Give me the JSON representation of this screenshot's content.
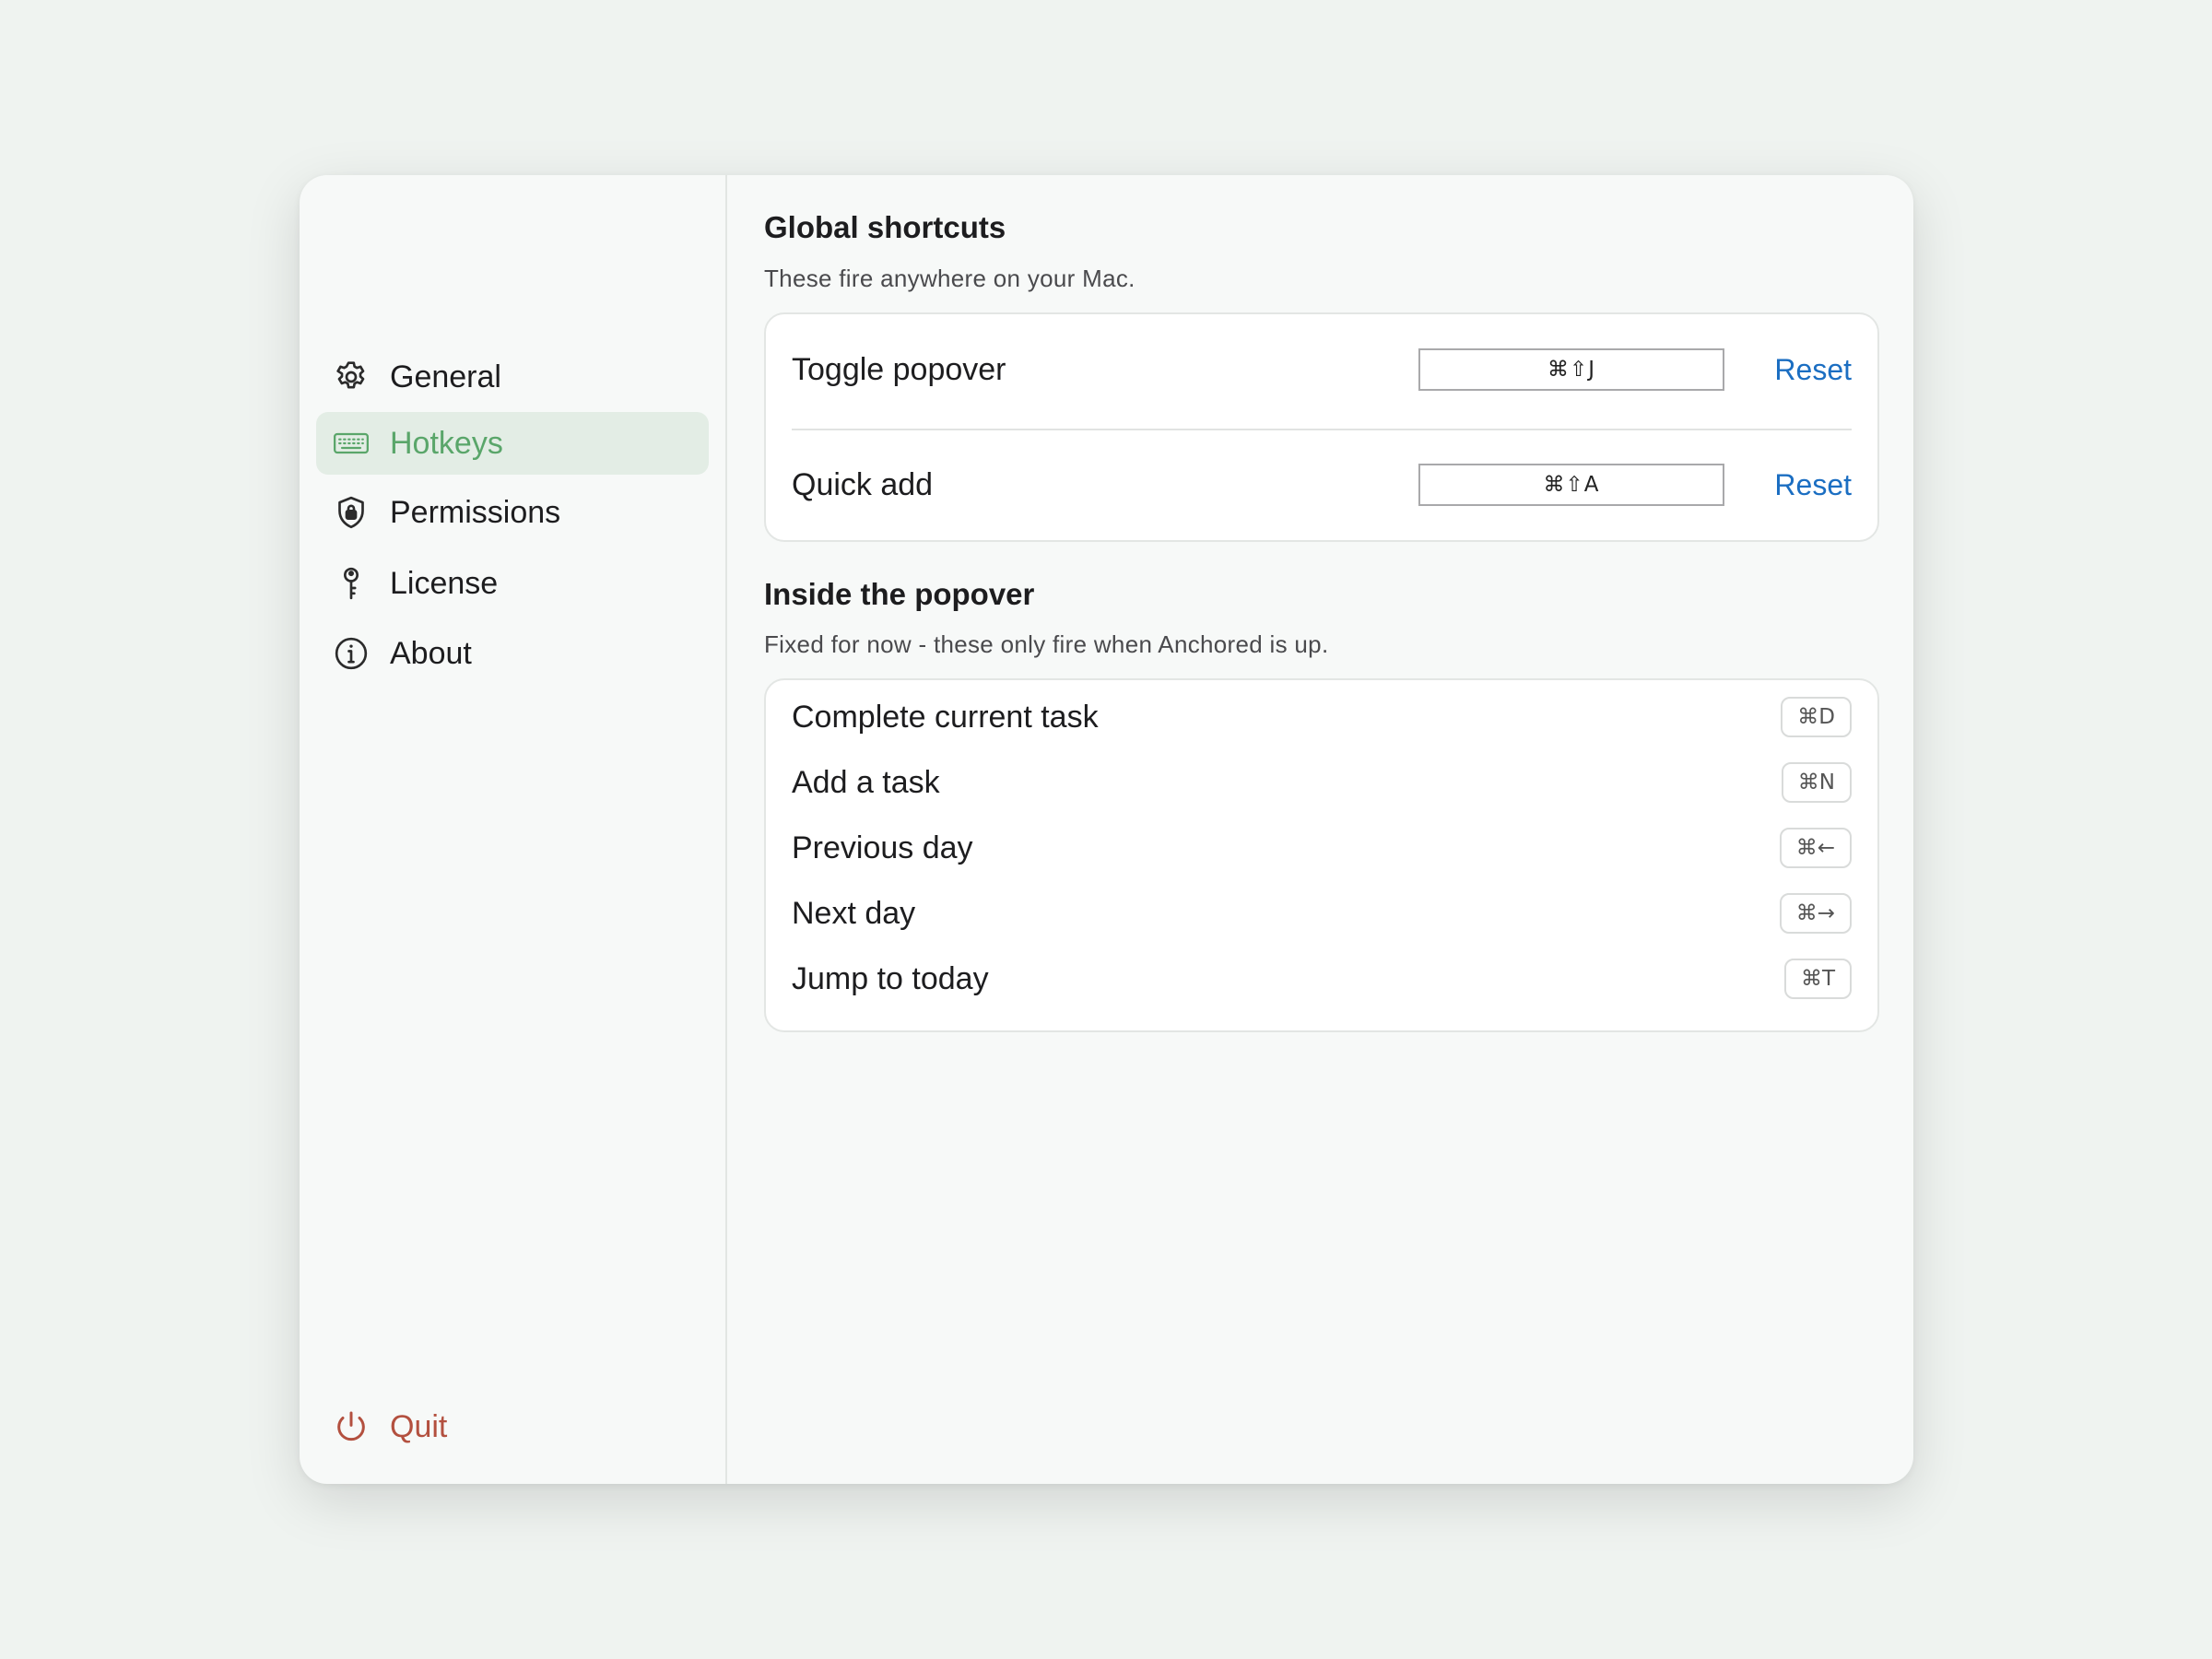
{
  "sidebar": {
    "items": [
      {
        "label": "General",
        "icon": "gear-icon"
      },
      {
        "label": "Hotkeys",
        "icon": "keyboard-icon",
        "active": true
      },
      {
        "label": "Permissions",
        "icon": "shield-lock-icon"
      },
      {
        "label": "License",
        "icon": "key-icon"
      },
      {
        "label": "About",
        "icon": "info-icon"
      }
    ],
    "quit": {
      "label": "Quit",
      "icon": "power-icon"
    }
  },
  "global": {
    "title": "Global shortcuts",
    "subtitle": "These fire anywhere on your Mac.",
    "rows": [
      {
        "label": "Toggle popover",
        "shortcut": "⌘⇧J",
        "reset": "Reset"
      },
      {
        "label": "Quick add",
        "shortcut": "⌘⇧A",
        "reset": "Reset"
      }
    ]
  },
  "popover": {
    "title": "Inside the popover",
    "subtitle": "Fixed for now - these only fire when Anchored is up.",
    "rows": [
      {
        "label": "Complete current task",
        "keys": "⌘D"
      },
      {
        "label": "Add a task",
        "keys": "⌘N"
      },
      {
        "label": "Previous day",
        "keys": "⌘←"
      },
      {
        "label": "Next day",
        "keys": "⌘→"
      },
      {
        "label": "Jump to today",
        "keys": "⌘T"
      }
    ]
  },
  "colors": {
    "accent": "#5aa66a",
    "link": "#1b6ec2",
    "quit": "#b3503f",
    "active_bg": "#e3ede5"
  }
}
